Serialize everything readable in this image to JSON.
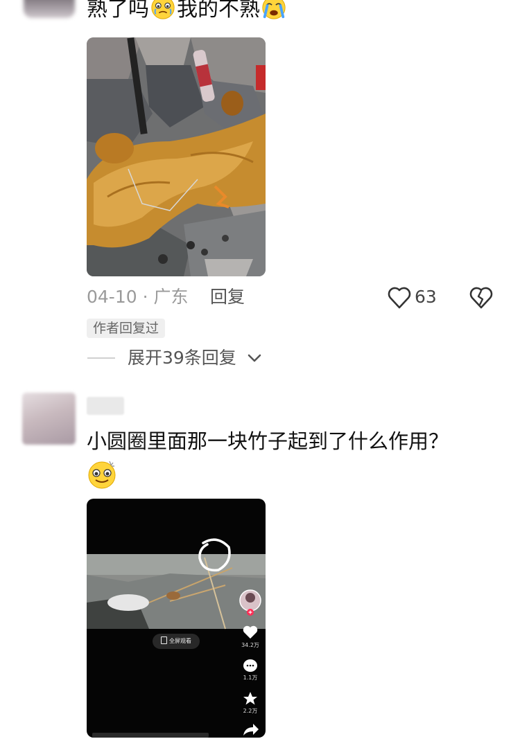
{
  "comment1": {
    "text_part1": "熟了吗",
    "text_part2": "我的不熟",
    "date": "04-10 · 广东",
    "reply_label": "回复",
    "like_count": "63",
    "author_badge": "作者回复过",
    "expand_replies": "展开39条回复"
  },
  "comment2": {
    "text": "小圆圈里面那一块竹子起到了什么作用？"
  },
  "video": {
    "fullscreen_label": "全屏观看",
    "likes": "34.2万",
    "comments": "1.1万",
    "favorites": "2.2万"
  },
  "icons": {
    "like": "heart-outline-icon",
    "dislike": "broken-heart-icon",
    "expand": "chevron-down-icon",
    "emoji_tearful": "tearful-face-emoji",
    "emoji_crying": "crying-face-emoji",
    "emoji_dizzy": "dizzy-face-emoji"
  }
}
